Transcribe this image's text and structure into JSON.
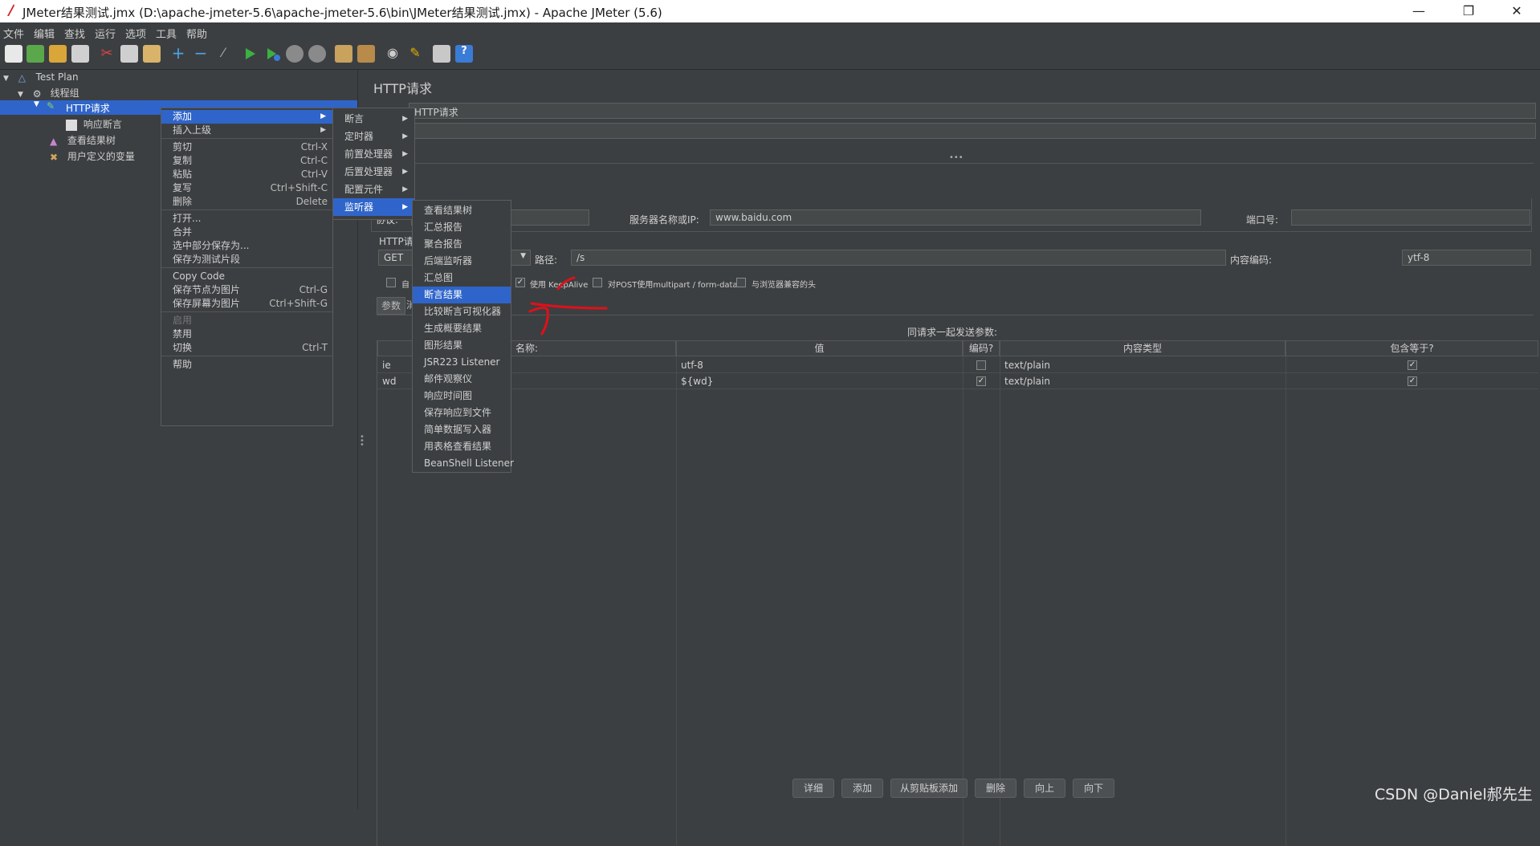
{
  "window": {
    "title": "JMeter结果测试.jmx (D:\\apache-jmeter-5.6\\apache-jmeter-5.6\\bin\\JMeter结果测试.jmx) - Apache JMeter (5.6)"
  },
  "menu": [
    "文件",
    "编辑",
    "查找",
    "运行",
    "选项",
    "工具",
    "帮助"
  ],
  "tree": {
    "test_plan": "Test Plan",
    "thread_group": "线程组",
    "http_request": "HTTP请求",
    "assertion": "响应断言",
    "view_results_tree": "查看结果树",
    "user_vars": "用户定义的变量"
  },
  "main": {
    "panel_title": "HTTP请求",
    "name_value": "HTTP请求",
    "protocol_label": "协议:",
    "server_label": "服务器名称或IP:",
    "server_value": "www.baidu.com",
    "port_label": "端口号:",
    "http_label": "HTTP请",
    "method": "GET",
    "path_label": "路径:",
    "path_value": "/s",
    "encoding_label": "内容编码:",
    "encoding_value": "ytf-8",
    "auto_label": "自",
    "keepalive_label": "使用 KeepAlive",
    "multipart_label": "对POST使用multipart / form-data",
    "browser_headers_label": "与浏览器兼容的头",
    "tab_params": "参数",
    "tab_body": "消",
    "send_params_title": "同请求一起发送参数:",
    "columns": [
      "名称:",
      "值",
      "编码?",
      "内容类型",
      "包含等于?"
    ],
    "rows": [
      {
        "name": "ie",
        "value": "utf-8",
        "encode": false,
        "type": "text/plain",
        "include": true
      },
      {
        "name": "wd",
        "value": "${wd}",
        "encode": true,
        "type": "text/plain",
        "include": true
      }
    ],
    "buttons": [
      "详细",
      "添加",
      "从剪贴板添加",
      "删除",
      "向上",
      "向下"
    ]
  },
  "context_menu": {
    "items": [
      {
        "label": "添加",
        "shortcut": "",
        "submenu": true,
        "selected": true
      },
      {
        "label": "插入上级",
        "shortcut": "",
        "submenu": true
      },
      {
        "sep": true
      },
      {
        "label": "剪切",
        "shortcut": "Ctrl-X"
      },
      {
        "label": "复制",
        "shortcut": "Ctrl-C"
      },
      {
        "label": "粘贴",
        "shortcut": "Ctrl-V"
      },
      {
        "label": "复写",
        "shortcut": "Ctrl+Shift-C"
      },
      {
        "label": "删除",
        "shortcut": "Delete"
      },
      {
        "sep": true
      },
      {
        "label": "打开...",
        "shortcut": ""
      },
      {
        "label": "合并",
        "shortcut": ""
      },
      {
        "label": "选中部分保存为...",
        "shortcut": ""
      },
      {
        "label": "保存为测试片段",
        "shortcut": ""
      },
      {
        "sep": true
      },
      {
        "label": "Copy Code",
        "shortcut": ""
      },
      {
        "label": "保存节点为图片",
        "shortcut": "Ctrl-G"
      },
      {
        "label": "保存屏幕为图片",
        "shortcut": "Ctrl+Shift-G"
      },
      {
        "sep": true
      },
      {
        "label": "启用",
        "shortcut": "",
        "disabled": true
      },
      {
        "label": "禁用",
        "shortcut": ""
      },
      {
        "label": "切换",
        "shortcut": "Ctrl-T"
      },
      {
        "sep": true
      },
      {
        "label": "帮助",
        "shortcut": ""
      }
    ]
  },
  "add_submenu": {
    "items": [
      {
        "label": "断言",
        "submenu": true
      },
      {
        "label": "定时器",
        "submenu": true
      },
      {
        "label": "前置处理器",
        "submenu": true
      },
      {
        "label": "后置处理器",
        "submenu": true
      },
      {
        "label": "配置元件",
        "submenu": true
      },
      {
        "label": "监听器",
        "submenu": true,
        "selected": true
      }
    ]
  },
  "listener_submenu": {
    "items": [
      {
        "label": "查看结果树"
      },
      {
        "label": "汇总报告"
      },
      {
        "label": "聚合报告"
      },
      {
        "label": "后端监听器"
      },
      {
        "label": "汇总图"
      },
      {
        "label": "断言结果",
        "selected": true
      },
      {
        "label": "比较断言可视化器"
      },
      {
        "label": "生成概要结果"
      },
      {
        "label": "图形结果"
      },
      {
        "label": "JSR223 Listener"
      },
      {
        "label": "邮件观察仪"
      },
      {
        "label": "响应时间图"
      },
      {
        "label": "保存响应到文件"
      },
      {
        "label": "简单数据写入器"
      },
      {
        "label": "用表格查看结果"
      },
      {
        "label": "BeanShell Listener"
      }
    ]
  },
  "watermark": "CSDN @Daniel郝先生",
  "colors": {
    "accent": "#2f65ca",
    "bg": "#3c3f41",
    "annotation": "#e0101a"
  }
}
